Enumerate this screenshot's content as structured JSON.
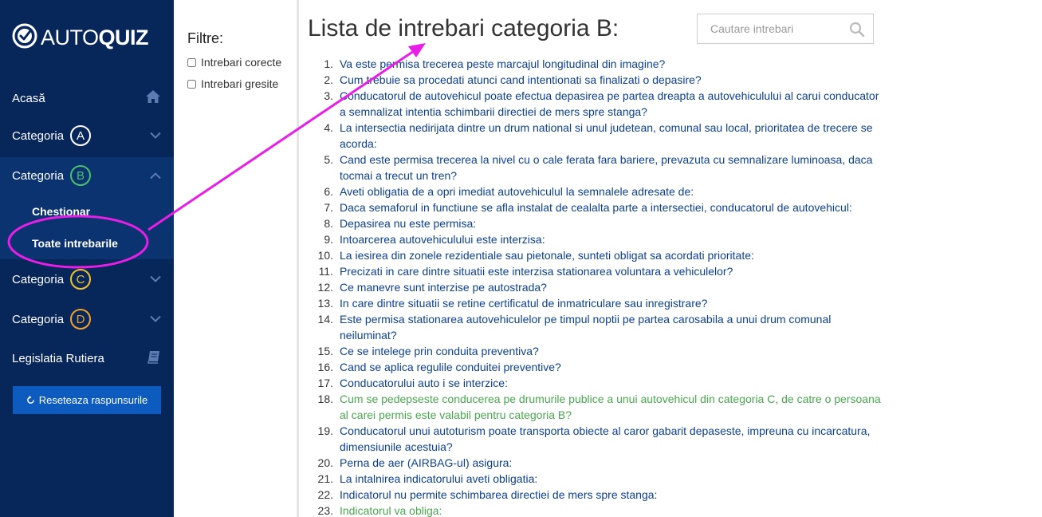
{
  "logo": {
    "part1": "AUTO",
    "part2": "QUIZ"
  },
  "sidebar": {
    "home": "Acasă",
    "category_label": "Categoria",
    "categories": [
      {
        "letter": "A"
      },
      {
        "letter": "B"
      },
      {
        "letter": "C"
      },
      {
        "letter": "D"
      }
    ],
    "sub_items": [
      "Chestionar",
      "Toate intrebarile"
    ],
    "legislation": "Legislatia Rutiera",
    "reset_button": "Reseteaza raspunsurile"
  },
  "filter": {
    "title": "Filtre:",
    "options": [
      "Intrebari corecte",
      "Intrebari gresite"
    ]
  },
  "main": {
    "title": "Lista de intrebari categoria B:",
    "search_placeholder": "Cautare intrebari"
  },
  "questions": [
    {
      "n": "1.",
      "text": "Va este permisa trecerea peste marcajul longitudinal din imagine?",
      "status": "default"
    },
    {
      "n": "2.",
      "text": "Cum trebuie sa procedati atunci cand intentionati sa finalizati o depasire?",
      "status": "default"
    },
    {
      "n": "3.",
      "text": "Conducatorul de autovehicul poate efectua depasirea pe partea dreapta a autovehiculului al carui conducator a semnalizat intentia schimbarii directiei de mers spre stanga?",
      "status": "default"
    },
    {
      "n": "4.",
      "text": "La intersectia nedirijata dintre un drum national si unul judetean, comunal sau local, prioritatea de trecere se acorda:",
      "status": "default"
    },
    {
      "n": "5.",
      "text": "Cand este permisa trecerea la nivel cu o cale ferata fara bariere, prevazuta cu semnalizare luminoasa, daca tocmai a trecut un tren?",
      "status": "default"
    },
    {
      "n": "6.",
      "text": "Aveti obligatia de a opri imediat autovehiculul la semnalele adresate de:",
      "status": "default"
    },
    {
      "n": "7.",
      "text": "Daca semaforul in functiune se afla instalat de cealalta parte a intersectiei, conducatorul de autovehicul:",
      "status": "default"
    },
    {
      "n": "8.",
      "text": "Depasirea nu este permisa:",
      "status": "default"
    },
    {
      "n": "9.",
      "text": "Intoarcerea autovehiculului este interzisa:",
      "status": "default"
    },
    {
      "n": "10.",
      "text": "La iesirea din zonele rezidentiale sau pietonale, sunteti obligat sa acordati prioritate:",
      "status": "default"
    },
    {
      "n": "11.",
      "text": "Precizati in care dintre situatii este interzisa stationarea voluntara a vehiculelor?",
      "status": "default"
    },
    {
      "n": "12.",
      "text": "Ce manevre sunt interzise pe autostrada?",
      "status": "default"
    },
    {
      "n": "13.",
      "text": "In care dintre situatii se retine certificatul de inmatriculare sau inregistrare?",
      "status": "default"
    },
    {
      "n": "14.",
      "text": "Este permisa stationarea autovehiculelor pe timpul noptii pe partea carosabila a unui drum comunal neiluminat?",
      "status": "default"
    },
    {
      "n": "15.",
      "text": "Ce se intelege prin conduita preventiva?",
      "status": "default"
    },
    {
      "n": "16.",
      "text": "Cand se aplica regulile conduitei preventive?",
      "status": "default"
    },
    {
      "n": "17.",
      "text": "Conducatorului auto i se interzice:",
      "status": "default"
    },
    {
      "n": "18.",
      "text": "Cum se pedepseste conducerea pe drumurile publice a unui autovehicul din categoria C, de catre o persoana al carei permis este valabil pentru categoria B?",
      "status": "correct"
    },
    {
      "n": "19.",
      "text": "Conducatorul unui autoturism poate transporta obiecte al caror gabarit depaseste, impreuna cu incarcatura, dimensiunile acestuia?",
      "status": "default"
    },
    {
      "n": "20.",
      "text": "Perna de aer (AIRBAG-ul) asigura:",
      "status": "default"
    },
    {
      "n": "21.",
      "text": "La intalnirea indicatorului aveti obligatia:",
      "status": "default"
    },
    {
      "n": "22.",
      "text": "Indicatorul nu permite schimbarea directiei de mers spre stanga:",
      "status": "default"
    },
    {
      "n": "23.",
      "text": "Indicatorul va obliga:",
      "status": "correct"
    }
  ],
  "colors": {
    "sidebar_bg": "#07265a",
    "sidebar_active": "#0a3370",
    "link": "#0d3f8f",
    "correct": "#4aa64f",
    "annotation": "#e91ee6"
  },
  "icons": [
    "check-circle-icon",
    "home-icon",
    "chevron-down-icon",
    "chevron-up-icon",
    "book-icon",
    "refresh-icon",
    "search-icon"
  ]
}
